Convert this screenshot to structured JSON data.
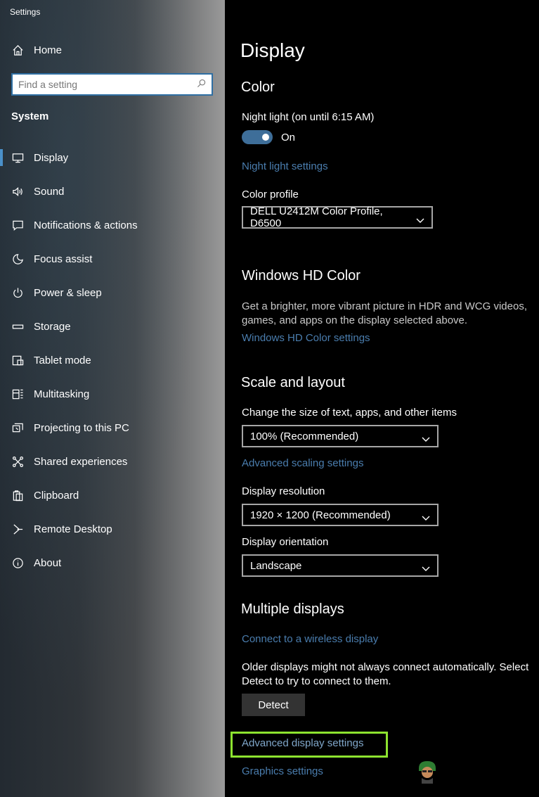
{
  "window": {
    "title": "Settings"
  },
  "sidebar": {
    "home_label": "Home",
    "search_placeholder": "Find a setting",
    "section_label": "System",
    "items": [
      {
        "label": "Display",
        "icon": "monitor-icon"
      },
      {
        "label": "Sound",
        "icon": "speaker-icon"
      },
      {
        "label": "Notifications & actions",
        "icon": "notification-icon"
      },
      {
        "label": "Focus assist",
        "icon": "moon-icon"
      },
      {
        "label": "Power & sleep",
        "icon": "power-icon"
      },
      {
        "label": "Storage",
        "icon": "storage-icon"
      },
      {
        "label": "Tablet mode",
        "icon": "tablet-icon"
      },
      {
        "label": "Multitasking",
        "icon": "multitasking-icon"
      },
      {
        "label": "Projecting to this PC",
        "icon": "projector-icon"
      },
      {
        "label": "Shared experiences",
        "icon": "share-icon"
      },
      {
        "label": "Clipboard",
        "icon": "clipboard-icon"
      },
      {
        "label": "Remote Desktop",
        "icon": "remote-desktop-icon"
      },
      {
        "label": "About",
        "icon": "info-icon"
      }
    ]
  },
  "main": {
    "title": "Display",
    "color": {
      "heading": "Color",
      "night_light_label": "Night light (on until 6:15 AM)",
      "toggle_state": "On",
      "night_light_link": "Night light settings",
      "profile_label": "Color profile",
      "profile_value": "DELL U2412M Color Profile, D6500"
    },
    "hd_color": {
      "heading": "Windows HD Color",
      "description": "Get a brighter, more vibrant picture in HDR and WCG videos, games, and apps on the display selected above.",
      "link": "Windows HD Color settings"
    },
    "scale": {
      "heading": "Scale and layout",
      "size_label": "Change the size of text, apps, and other items",
      "size_value": "100% (Recommended)",
      "advanced_link": "Advanced scaling settings",
      "resolution_label": "Display resolution",
      "resolution_value": "1920 × 1200 (Recommended)",
      "orientation_label": "Display orientation",
      "orientation_value": "Landscape"
    },
    "multiple": {
      "heading": "Multiple displays",
      "wireless_link": "Connect to a wireless display",
      "description": "Older displays might not always connect automatically. Select Detect to try to connect to them.",
      "detect_button": "Detect",
      "advanced_display_link": "Advanced display settings",
      "graphics_link": "Graphics settings"
    }
  },
  "colors": {
    "accent": "#3e6e99",
    "link": "#4a7dae",
    "highlight": "#8de32f"
  }
}
